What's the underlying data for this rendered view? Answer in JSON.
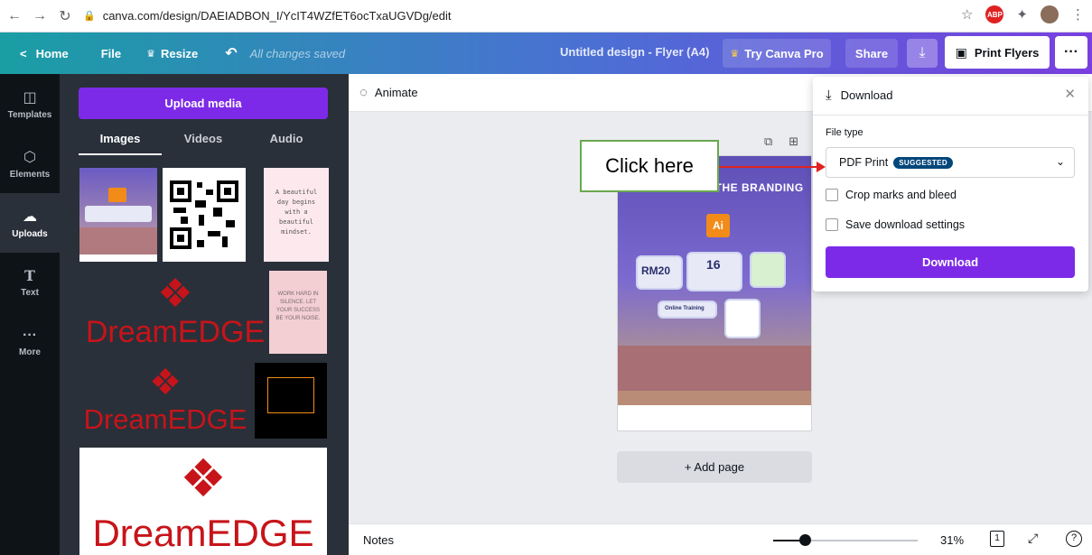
{
  "browser": {
    "url": "canva.com/design/DAEIADBON_I/YcIT4WZfET6ocTxaUGVDg/edit"
  },
  "header": {
    "home": "Home",
    "file": "File",
    "resize": "Resize",
    "saved_status": "All changes saved",
    "doc_title": "Untitled design - Flyer (A4)",
    "try_pro": "Try Canva Pro",
    "share": "Share",
    "print": "Print Flyers"
  },
  "rail": {
    "items": [
      {
        "label": "Templates",
        "icon": "templates-icon"
      },
      {
        "label": "Elements",
        "icon": "elements-icon"
      },
      {
        "label": "Uploads",
        "icon": "uploads-icon",
        "active": true
      },
      {
        "label": "Text",
        "icon": "text-icon"
      },
      {
        "label": "More",
        "icon": "more-icon"
      }
    ]
  },
  "panel": {
    "upload_button": "Upload media",
    "tabs": [
      "Images",
      "Videos",
      "Audio"
    ],
    "active_tab": "Images",
    "thumb_texts": {
      "quote1": "A beautiful day begins with a beautiful mindset.",
      "quote2": "WORK HARD IN SILENCE. LET YOUR SUCCESS BE YOUR NOISE.",
      "brand": "DreamEDGE"
    }
  },
  "toolbar": {
    "animate": "Animate"
  },
  "canvas": {
    "flyer_title": "ILLUSTRATOR: THE BRANDING",
    "flyer_badge": "Ai",
    "flyer_price": "RM20",
    "flyer_age": "16",
    "flyer_online": "Online Training",
    "add_page": "+ Add page"
  },
  "bottom": {
    "notes": "Notes",
    "zoom": "31%",
    "zoom_fraction": 0.22,
    "page_count": "1"
  },
  "download_panel": {
    "title": "Download",
    "file_type_label": "File type",
    "file_type_value": "PDF Print",
    "badge": "SUGGESTED",
    "option_crop": "Crop marks and bleed",
    "option_save": "Save download settings",
    "download_button": "Download"
  },
  "annotation": {
    "callout": "Click here"
  },
  "colors": {
    "brand_purple": "#7d2ae8",
    "rail_bg": "#0e1318",
    "panel_bg": "#293039",
    "badge_blue": "#03467a",
    "callout_border": "#6aa84f",
    "arrow_red": "#e02121",
    "brand_red": "#c7141a"
  }
}
